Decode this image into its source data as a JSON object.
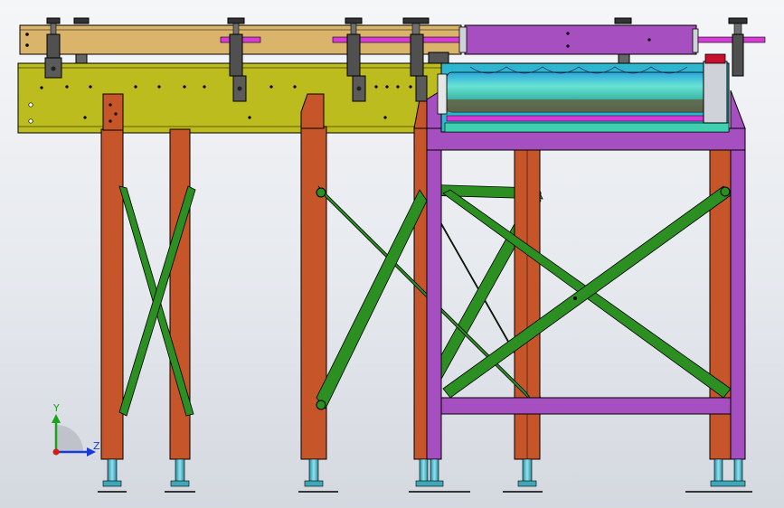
{
  "viewport": {
    "triad": {
      "y_label": "Y",
      "z_label": "Z"
    }
  },
  "colors": {
    "background_top": "#f5f6f8",
    "background_bottom": "#d4d8df",
    "top_rail": "#d9b46a",
    "side_beam": "#bcbc1e",
    "legs": "#c6562a",
    "bracing": "#2b8f22",
    "purple_frame": "#a64fc0",
    "roller": "#3fb8b0",
    "rod": "#d83ad8",
    "clamp": "#4a4a4a",
    "foot": "#3fa8b8",
    "edge": "#000000"
  },
  "icons": {
    "axis_triad": "axis-triad-icon",
    "clamp": "clamp-icon",
    "leveling_foot": "leveling-foot-icon"
  }
}
